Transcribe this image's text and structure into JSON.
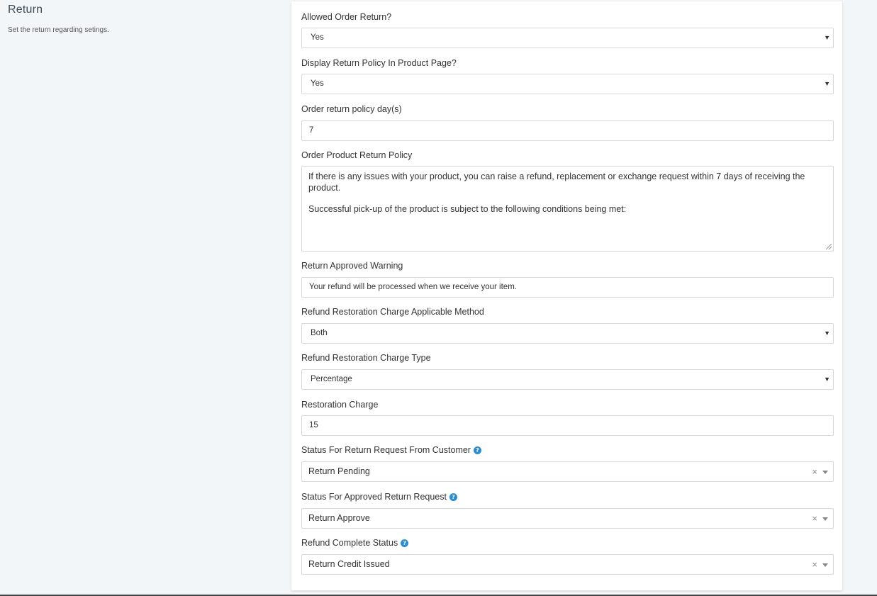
{
  "section": {
    "title": "Return",
    "subtitle": "Set the return regarding setings."
  },
  "fields": {
    "allowed_order_return": {
      "label": "Allowed Order Return?",
      "value": "Yes"
    },
    "display_return_policy": {
      "label": "Display Return Policy In Product Page?",
      "value": "Yes"
    },
    "return_policy_days": {
      "label": "Order return policy day(s)",
      "value": "7"
    },
    "product_return_policy": {
      "label": "Order Product Return Policy",
      "line1": "If there is any issues with your product, you can raise a refund, replacement or exchange request within 7 days of receiving the product.",
      "line2": "Successful pick-up of the product is subject to the following conditions being met:"
    },
    "return_approved_warning": {
      "label": "Return Approved Warning",
      "value": "Your refund will be processed when we receive your item."
    },
    "restoration_charge_method": {
      "label": "Refund Restoration Charge Applicable Method",
      "value": "Both"
    },
    "restoration_charge_type": {
      "label": "Refund Restoration Charge Type",
      "value": "Percentage"
    },
    "restoration_charge": {
      "label": "Restoration Charge",
      "value": "15"
    },
    "status_return_request": {
      "label": "Status For Return Request From Customer",
      "value": "Return Pending"
    },
    "status_approved_return": {
      "label": "Status For Approved Return Request",
      "value": "Return Approve"
    },
    "refund_complete_status": {
      "label": "Refund Complete Status",
      "value": "Return Credit Issued"
    }
  },
  "glyphs": {
    "caret": "▼",
    "clear": "×",
    "help": "?"
  },
  "colors": {
    "page_bg": "#f3f6f9",
    "card_bg": "#ffffff",
    "border": "#d6d9dc",
    "help_icon": "#2a8cd2"
  }
}
